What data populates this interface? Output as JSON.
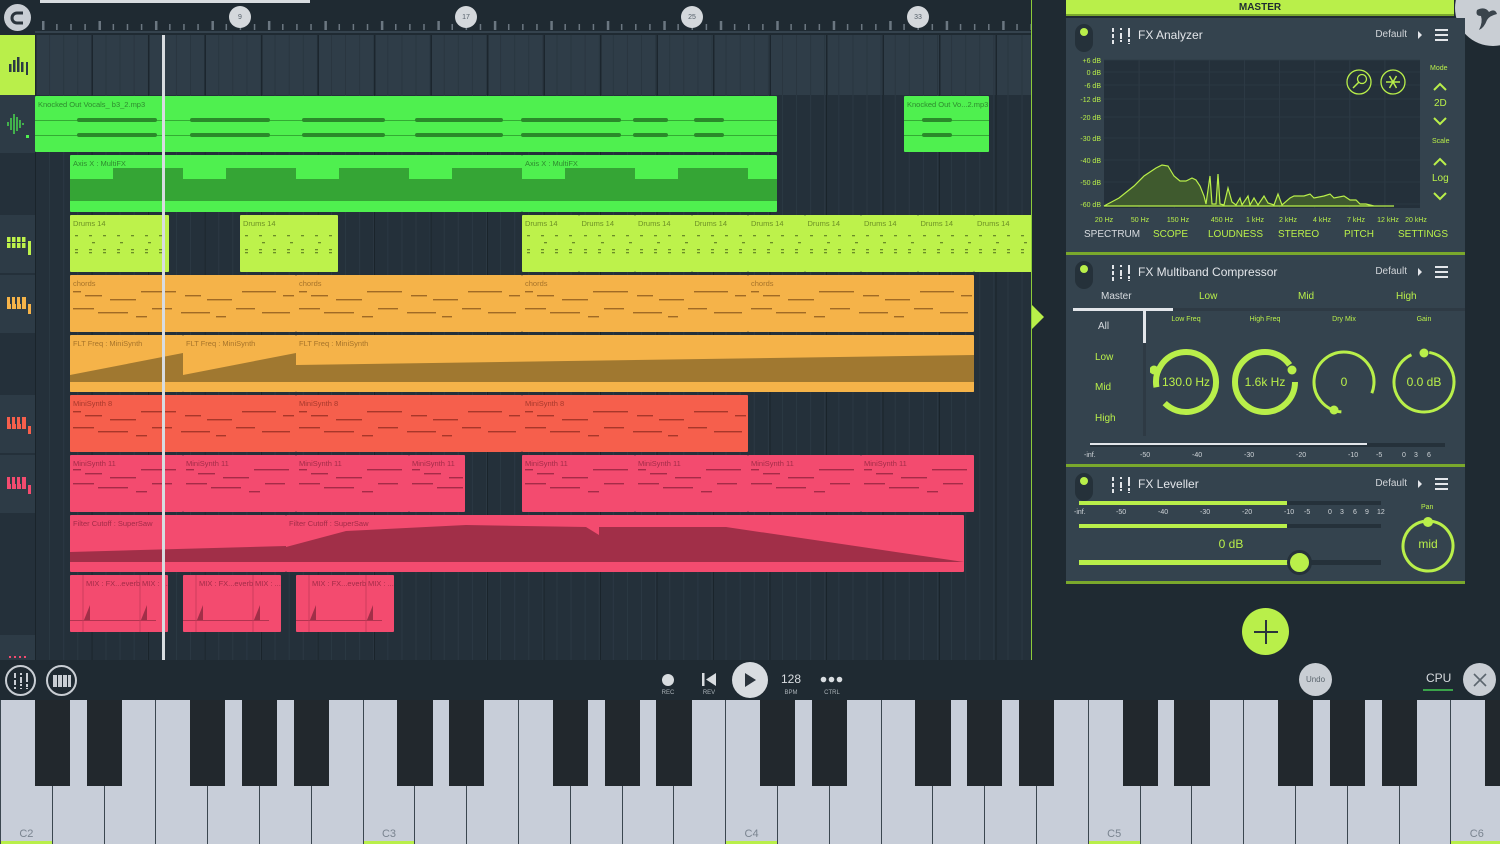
{
  "playlist": {
    "bar_markers": [
      "9",
      "17",
      "25",
      "33"
    ],
    "tracks": [
      {
        "name": "track-1",
        "icon": "equalizer-bars-icon",
        "active": true
      },
      {
        "name": "track-2",
        "icon": "waveform-icon"
      },
      {
        "name": "track-3",
        "icon": ""
      },
      {
        "name": "track-4",
        "icon": "drum-pads-icon"
      },
      {
        "name": "track-5",
        "icon": "piano-keys-icon"
      },
      {
        "name": "track-6",
        "icon": ""
      },
      {
        "name": "track-7",
        "icon": "piano-keys-icon"
      },
      {
        "name": "track-8",
        "icon": "piano-keys-icon"
      },
      {
        "name": "track-9",
        "icon": ""
      },
      {
        "name": "track-10",
        "icon": ""
      }
    ],
    "clips": [
      {
        "label": "Knocked Out Vocals_ b3_2.mp3",
        "type": "audio"
      },
      {
        "label": "Knocked Out Vo...2.mp3",
        "type": "audio"
      },
      {
        "label": "Axis X : MultiFX",
        "type": "automation"
      },
      {
        "label": "Axis X : MultiFX",
        "type": "automation"
      },
      {
        "label": "Drums 14",
        "type": "pattern"
      },
      {
        "label": "chords",
        "type": "pattern"
      },
      {
        "label": "FLT Freq : MiniSynth",
        "type": "automation"
      },
      {
        "label": "MiniSynth 8",
        "type": "pattern"
      },
      {
        "label": "MiniSynth 11",
        "type": "pattern"
      },
      {
        "label": "Filter Cutoff : SuperSaw",
        "type": "automation"
      },
      {
        "label": "MIX : FX...everb",
        "type": "automation"
      },
      {
        "label": "MIX : ...",
        "type": "automation"
      }
    ]
  },
  "master": {
    "title": "MASTER",
    "analyzer": {
      "title": "FX Analyzer",
      "preset": "Default",
      "db_labels": [
        "+6 dB",
        "0 dB",
        "-6 dB",
        "-12 dB",
        "-20 dB",
        "-30 dB",
        "-40 dB",
        "-50 dB",
        "-60 dB"
      ],
      "freq_labels": [
        "20 Hz",
        "50 Hz",
        "150 Hz",
        "450 Hz",
        "1 kHz",
        "2 kHz",
        "4 kHz",
        "7 kHz",
        "12 kHz",
        "20 kHz"
      ],
      "mode_label": "Mode",
      "mode_value": "2D",
      "scale_label": "Scale",
      "scale_value": "Log",
      "tabs": [
        "SPECTRUM",
        "SCOPE",
        "LOUDNESS",
        "STEREO",
        "PITCH",
        "SETTINGS"
      ],
      "active_tab": "SPECTRUM"
    },
    "compressor": {
      "title": "FX Multiband Compressor",
      "preset": "Default",
      "tabs": [
        "Master",
        "Low",
        "Mid",
        "High"
      ],
      "active_tab": "Master",
      "bands": [
        "All",
        "Low",
        "Mid",
        "High"
      ],
      "active_band": "All",
      "knobs": [
        {
          "label": "Low Freq",
          "value": "130.0 Hz"
        },
        {
          "label": "High Freq",
          "value": "1.6k Hz"
        },
        {
          "label": "Dry Mix",
          "value": "0"
        },
        {
          "label": "Gain",
          "value": "0.0 dB"
        }
      ],
      "meter_labels": [
        "-inf.",
        "-50",
        "-40",
        "-30",
        "-20",
        "-10",
        "-5",
        "0",
        "3",
        "6"
      ],
      "meter_level": 0.78
    },
    "leveller": {
      "title": "FX Leveller",
      "preset": "Default",
      "meter_labels": [
        "-inf.",
        "-50",
        "-40",
        "-30",
        "-20",
        "-10",
        "-5",
        "0",
        "3",
        "6",
        "9",
        "12"
      ],
      "meter_level_l": 0.69,
      "meter_level_r": 0.69,
      "volume_label": "0 dB",
      "volume_fraction": 0.73,
      "pan_label": "Pan",
      "pan_value": "mid"
    }
  },
  "transport": {
    "rec_label": "REC",
    "rev_label": "REV",
    "bpm_value": "128",
    "bpm_label": "BPM",
    "ctrl_label": "CTRL",
    "undo_label": "Undo",
    "cpu_label": "CPU"
  },
  "keyboard": {
    "octave_labels": [
      "C2",
      "C3",
      "C4",
      "C5",
      "C6"
    ]
  },
  "colors": {
    "accent": "#b9ef4a",
    "audio_clip": "#4ff04f",
    "drums_clip": "#bdf24b",
    "chords_clip": "#f5b349",
    "synth8_clip": "#f65f4c",
    "synth11_clip": "#f34b6f"
  }
}
